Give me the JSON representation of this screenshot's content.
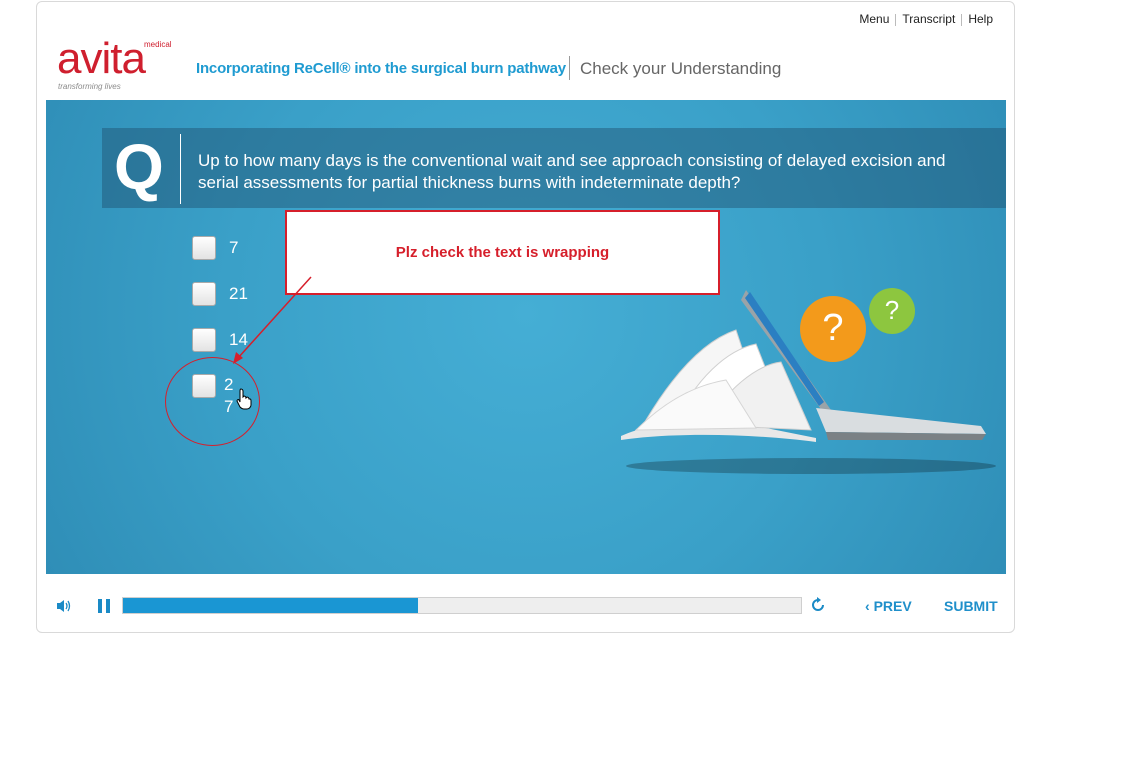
{
  "nav": {
    "menu": "Menu",
    "transcript": "Transcript",
    "help": "Help"
  },
  "logo": {
    "word": "avita",
    "medical": "medical",
    "tagline": "transforming lives"
  },
  "header": {
    "course_title": "Incorporating ReCell® into the surgical burn pathway",
    "section_title": "Check your Understanding"
  },
  "question": {
    "letter": "Q",
    "text": "Up to how many days is the conventional wait and see approach consisting of delayed excision and serial assessments for partial thickness burns with indeterminate depth?",
    "options": [
      "7",
      "21",
      "14",
      "27"
    ]
  },
  "annotation": {
    "note": "Plz check the text is wrapping",
    "color": "#d61f2b"
  },
  "illustration": {
    "bubble_big": "?",
    "bubble_small": "?"
  },
  "controls": {
    "progress_fraction": 0.435,
    "prev_label": "PREV",
    "submit_label": "SUBMIT"
  },
  "colors": {
    "accent": "#1f9bd1",
    "brand_red": "#cf1f2e",
    "stage": "#3ca3cb"
  }
}
